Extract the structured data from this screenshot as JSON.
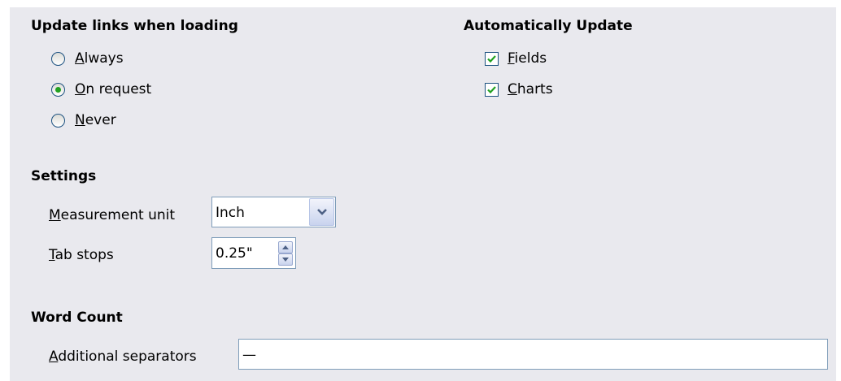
{
  "update_links": {
    "heading": "Update links when loading",
    "options": [
      {
        "mnemonic": "A",
        "rest": "lways",
        "selected": false
      },
      {
        "mnemonic": "O",
        "rest": "n request",
        "selected": true
      },
      {
        "mnemonic": "N",
        "rest": "ever",
        "selected": false
      }
    ]
  },
  "auto_update": {
    "heading": "Automatically Update",
    "items": [
      {
        "mnemonic": "F",
        "rest": "ields",
        "checked": true
      },
      {
        "mnemonic": "C",
        "rest": "harts",
        "checked": true
      }
    ]
  },
  "settings": {
    "heading": "Settings",
    "measurement_unit": {
      "mnemonic": "M",
      "rest": "easurement unit",
      "value": "Inch"
    },
    "tab_stops": {
      "mnemonic": "T",
      "rest": "ab stops",
      "value": "0.25\""
    }
  },
  "word_count": {
    "heading": "Word Count",
    "separators": {
      "mnemonic": "A",
      "rest": "dditional separators",
      "value": "—"
    }
  },
  "colors": {
    "panel_bg": "#e9e9ee",
    "radio_dot": "#21a121",
    "check_mark": "#21a121",
    "border_blue": "#1c5180"
  }
}
